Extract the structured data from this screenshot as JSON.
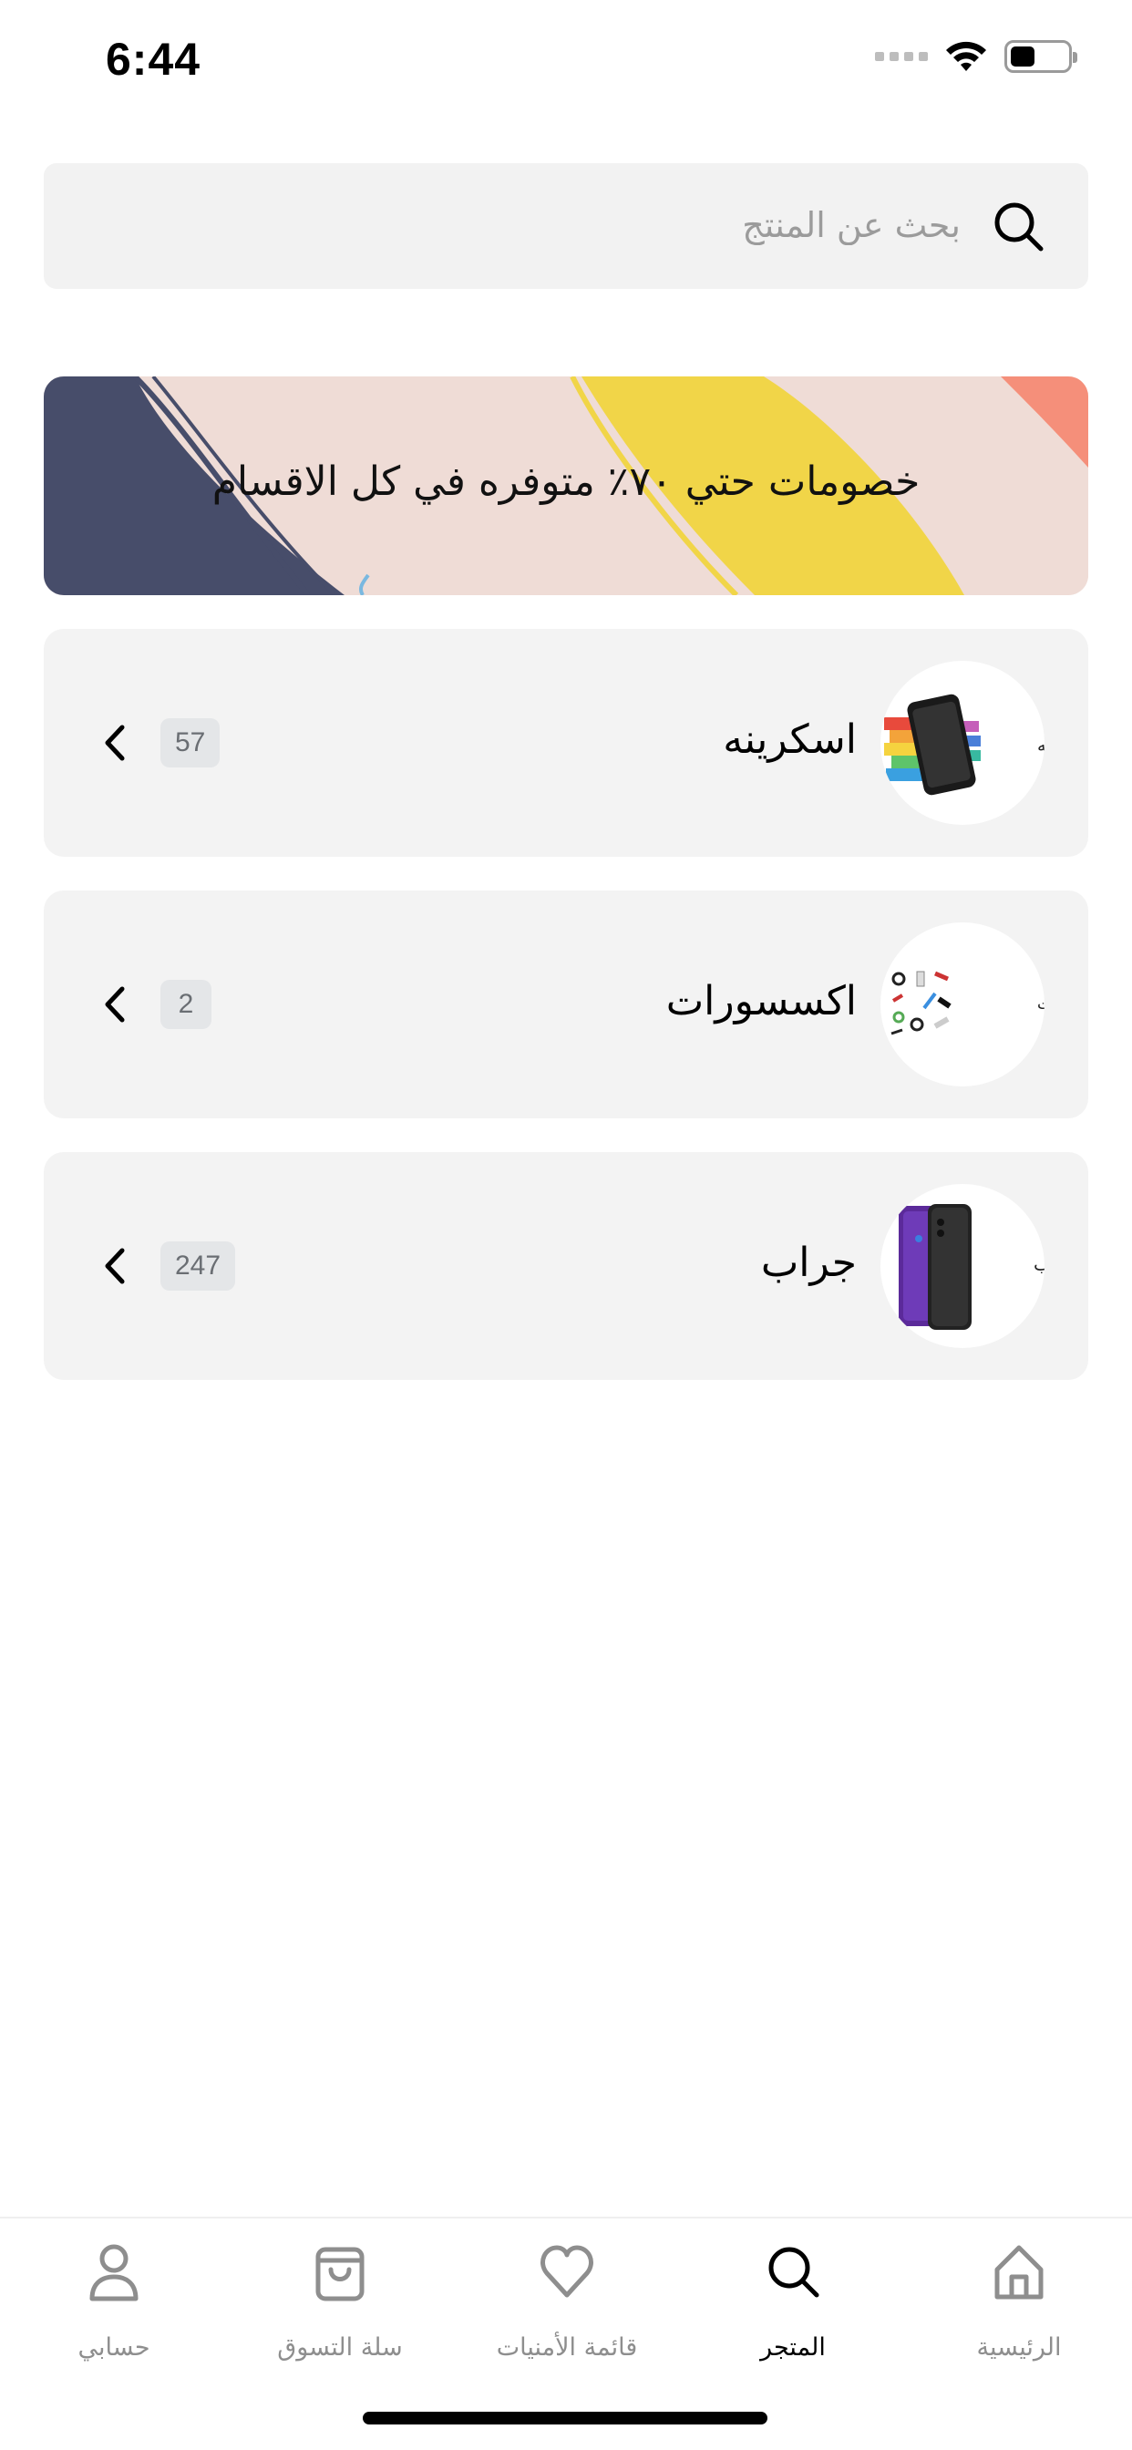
{
  "status_bar": {
    "time": "6:44"
  },
  "search": {
    "placeholder": "بحث عن المنتج"
  },
  "banner": {
    "text": "خصومات حتي ٧٠٪ متوفره في كل الاقسام"
  },
  "categories": [
    {
      "name": "اسكرينه",
      "count": "57",
      "thumb_label": "إسكرينه",
      "icon": "screen-protector-image"
    },
    {
      "name": "اكسسورات",
      "count": "2",
      "thumb_label": "إكسسوارات",
      "icon": "accessories-image"
    },
    {
      "name": "جراب",
      "count": "247",
      "thumb_label": "جراب",
      "icon": "phone-case-image"
    }
  ],
  "nav": {
    "items": [
      {
        "label": "حسابي",
        "icon": "person-icon"
      },
      {
        "label": "سلة التسوق",
        "icon": "shopping-bag-icon"
      },
      {
        "label": "قائمة الأمنيات",
        "icon": "heart-icon"
      },
      {
        "label": "المتجر",
        "icon": "search-icon",
        "active": true
      },
      {
        "label": "الرئيسية",
        "icon": "home-icon"
      }
    ]
  },
  "colors": {
    "active": "#000000",
    "inactive": "#8e8e8e",
    "card_bg": "#f3f3f3",
    "badge_bg": "#e4e6e8"
  }
}
